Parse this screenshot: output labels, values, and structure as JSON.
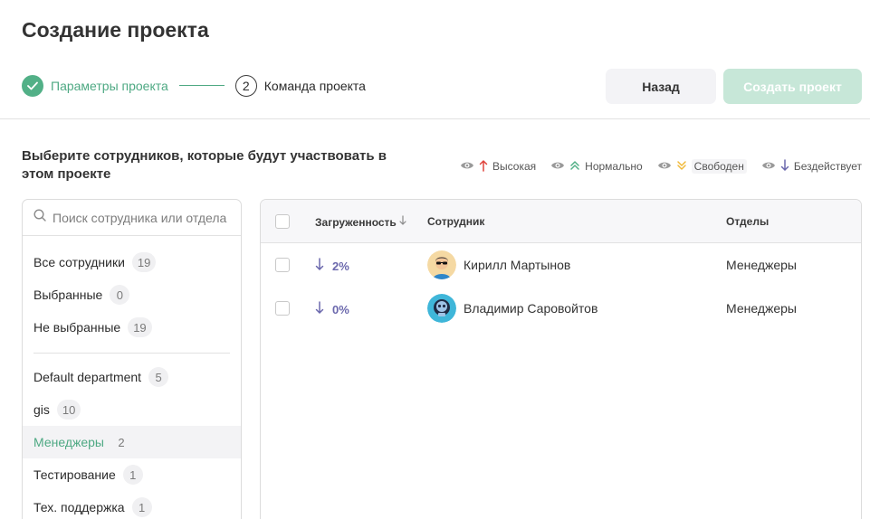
{
  "page": {
    "title": "Создание проекта"
  },
  "stepper": {
    "step1_label": "Параметры проекта",
    "step2_number": "2",
    "step2_label": "Команда проекта"
  },
  "buttons": {
    "back": "Назад",
    "create": "Создать проект"
  },
  "select_hint": "Выберите сотрудников, которые будут участвовать в этом проекте",
  "legend": [
    {
      "label": "Высокая",
      "icon": "arrow-up-icon",
      "color": "#e0443c"
    },
    {
      "label": "Нормально",
      "icon": "double-chevron-up-icon",
      "color": "#52b087"
    },
    {
      "label": "Свободен",
      "icon": "double-chevron-down-icon",
      "color": "#f0b93a"
    },
    {
      "label": "Бездействует",
      "icon": "arrow-down-icon",
      "color": "#6b68ad"
    }
  ],
  "sidebar": {
    "search_placeholder": "Поиск сотрудника или отдела",
    "filters": [
      {
        "label": "Все сотрудники",
        "count": "19"
      },
      {
        "label": "Выбранные",
        "count": "0"
      },
      {
        "label": "Не выбранные",
        "count": "19"
      }
    ],
    "departments": [
      {
        "label": "Default department",
        "count": "5"
      },
      {
        "label": "gis",
        "count": "10"
      },
      {
        "label": "Менеджеры",
        "count": "2",
        "active": true
      },
      {
        "label": "Тестирование",
        "count": "1"
      },
      {
        "label": "Тех. поддержка",
        "count": "1"
      }
    ]
  },
  "table": {
    "columns": {
      "load": "Загруженность",
      "employee": "Сотрудник",
      "departments": "Отделы"
    },
    "rows": [
      {
        "load": "2%",
        "name": "Кирилл Мартынов",
        "department": "Менеджеры"
      },
      {
        "load": "0%",
        "name": "Владимир Саровойтов",
        "department": "Менеджеры"
      }
    ]
  },
  "colors": {
    "accent": "#52b087",
    "idle": "#6b68ad",
    "create_disabled": "#c7e7d8"
  }
}
